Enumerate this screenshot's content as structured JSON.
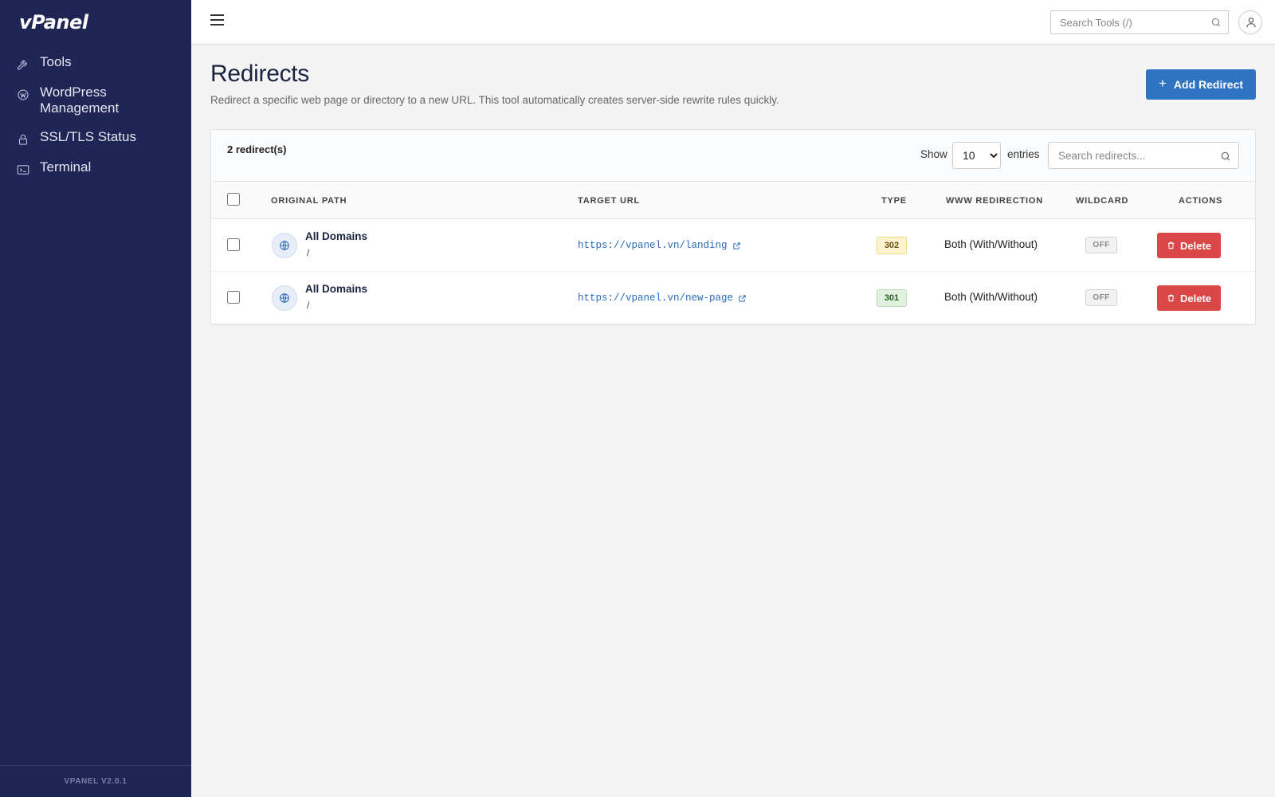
{
  "app": {
    "logo": "vPanel",
    "version": "VPANEL V2.0.1"
  },
  "sidebar": {
    "items": [
      {
        "label": "Tools",
        "icon": "wrench-icon"
      },
      {
        "label": "WordPress Management",
        "icon": "wordpress-icon"
      },
      {
        "label": "SSL/TLS Status",
        "icon": "lock-icon"
      },
      {
        "label": "Terminal",
        "icon": "terminal-icon"
      }
    ]
  },
  "topbar": {
    "search_placeholder": "Search Tools (/)"
  },
  "page": {
    "title": "Redirects",
    "description": "Redirect a specific web page or directory to a new URL. This tool automatically creates server-side rewrite rules quickly.",
    "add_button": "Add Redirect"
  },
  "table": {
    "count_label": "2 redirect(s)",
    "show_label": "Show",
    "entries_value": "10",
    "entries_label": "entries",
    "search_placeholder": "Search redirects...",
    "columns": [
      "ORIGINAL PATH",
      "TARGET URL",
      "TYPE",
      "WWW REDIRECTION",
      "WILDCARD",
      "ACTIONS"
    ],
    "rows": [
      {
        "domain": "All Domains",
        "path": "/",
        "target": "https://vpanel.vn/landing",
        "type": "302",
        "www": "Both (With/Without)",
        "wildcard": "OFF",
        "action": "Delete"
      },
      {
        "domain": "All Domains",
        "path": "/",
        "target": "https://vpanel.vn/new-page",
        "type": "301",
        "www": "Both (With/Without)",
        "wildcard": "OFF",
        "action": "Delete"
      }
    ]
  },
  "colors": {
    "sidebar": "#1f2555",
    "primary": "#2f74c0",
    "danger": "#da4747"
  }
}
